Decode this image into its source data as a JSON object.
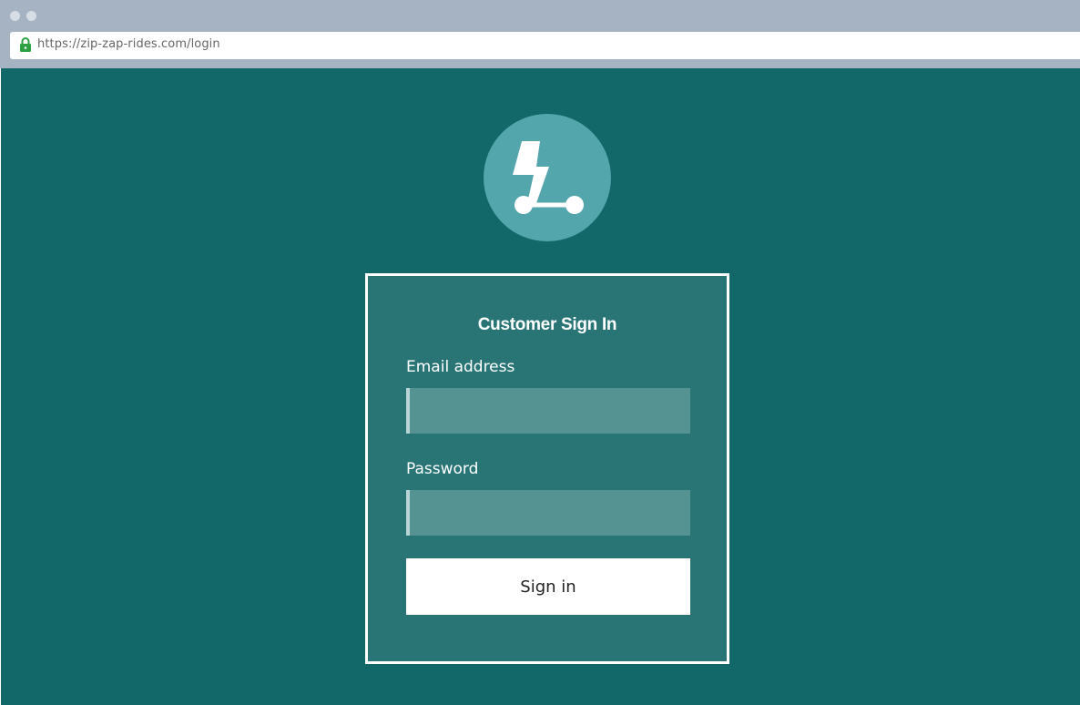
{
  "browser": {
    "url": "https://zip-zap-rides.com/login",
    "lock_icon": "lock-icon"
  },
  "logo": {
    "icon": "scooter-lightning-icon"
  },
  "login": {
    "title": "Customer Sign In",
    "email_label": "Email address",
    "email_value": "",
    "password_label": "Password",
    "password_value": "",
    "submit_label": "Sign in"
  },
  "colors": {
    "page_background": "#126769",
    "card_background": "#297576",
    "logo_circle": "#53a6ab",
    "input_background": "#559292",
    "chrome_background": "#a5b3c3",
    "lock_green": "#2da043"
  }
}
